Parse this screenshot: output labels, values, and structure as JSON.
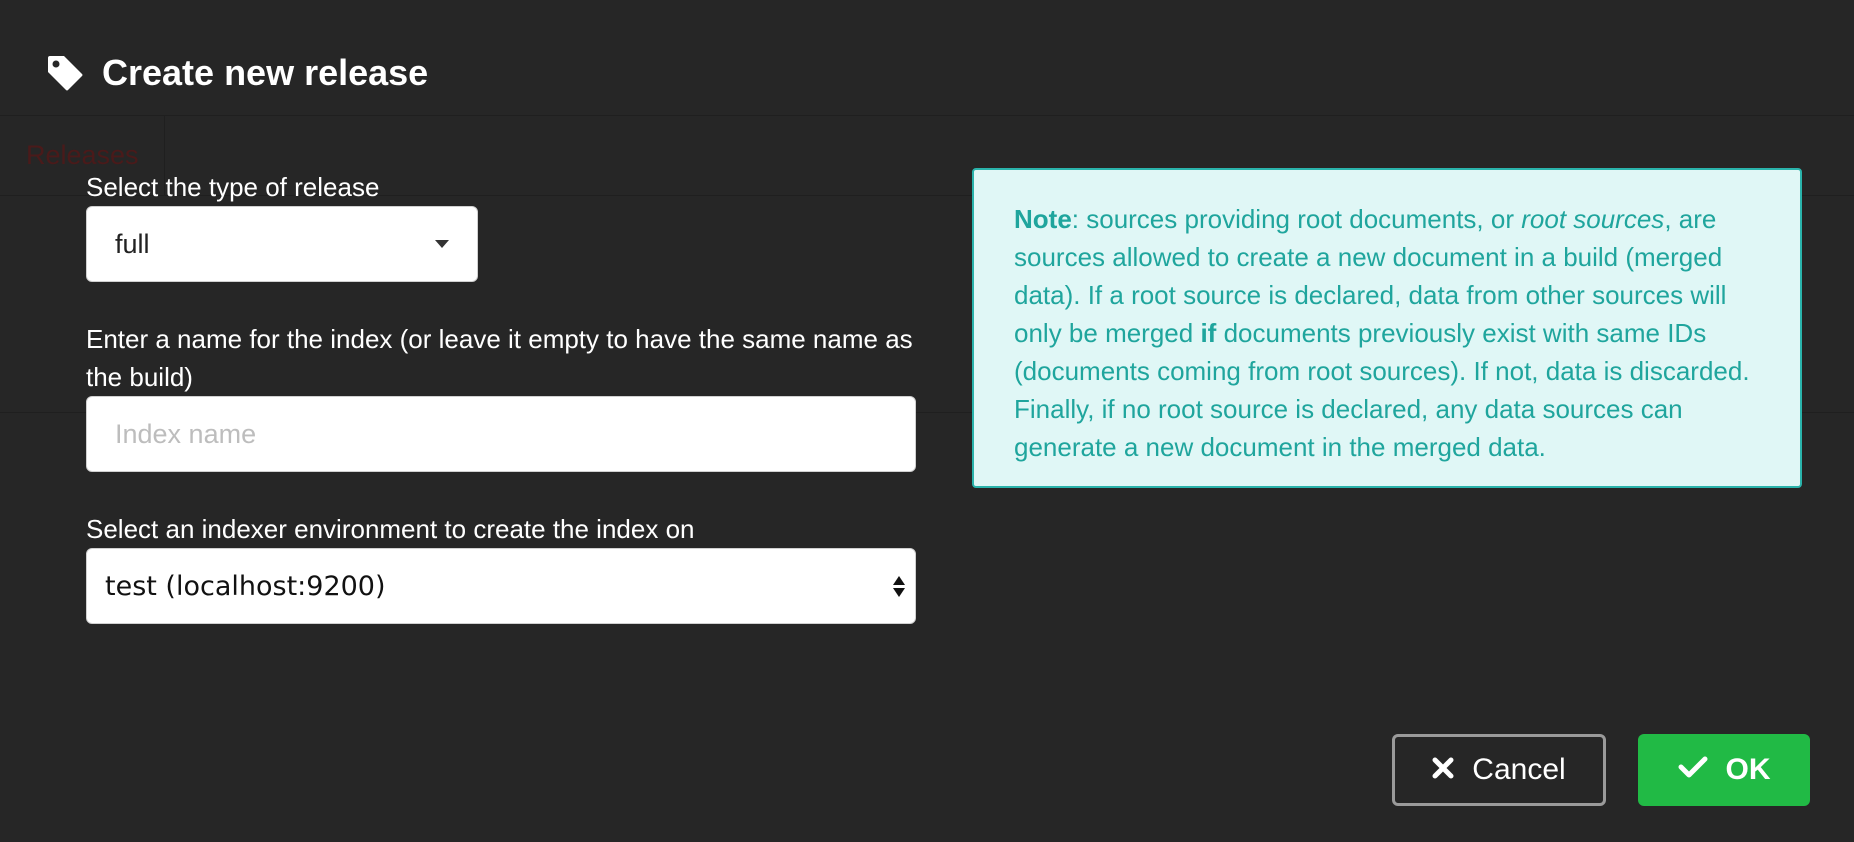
{
  "modal": {
    "title": "Create new release",
    "title_icon": "tag-icon"
  },
  "background": {
    "tab_label": "Releases"
  },
  "form": {
    "release_type": {
      "label": "Select the type of release",
      "value": "full"
    },
    "index_name": {
      "label": "Enter a name for the index (or leave it empty to have the same name as the build)",
      "placeholder": "Index name",
      "value": ""
    },
    "environment": {
      "label": "Select an indexer environment to create the index on",
      "value": "test (localhost:9200)"
    }
  },
  "note": {
    "lead": "Note",
    "text_1": ": sources providing root documents, or ",
    "emphasis": "root sources",
    "text_2": ", are sources allowed to create a new document in a build (merged data). If a root source is declared, data from other sources will only be merged ",
    "strong_if": "if",
    "text_3": " documents previously exist with same IDs (documents coming from root sources). If not, data is discarded. Finally, if no root source is declared, any data sources can generate a new document in the merged data."
  },
  "actions": {
    "cancel_label": "Cancel",
    "cancel_icon": "close-icon",
    "ok_label": "OK",
    "ok_icon": "checkmark-icon"
  },
  "colors": {
    "background": "#262626",
    "note_bg": "#e0f7f6",
    "note_text": "#1fa59d",
    "ok_button": "#21ba45"
  }
}
